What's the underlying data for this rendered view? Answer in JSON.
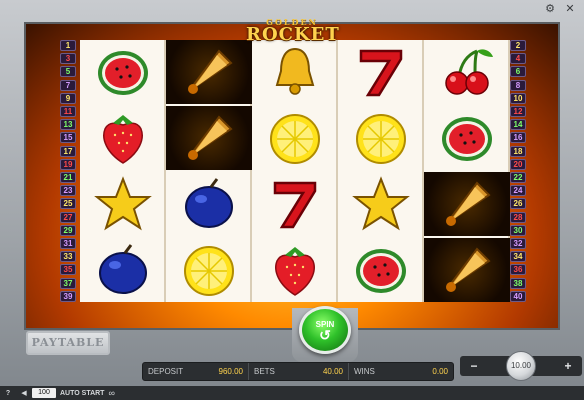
{
  "game": {
    "logo_top": "GOLDEN",
    "logo_main": "ROCKET"
  },
  "lines": {
    "left": [
      "1",
      "3",
      "5",
      "7",
      "9",
      "11",
      "13",
      "15",
      "17",
      "19",
      "21",
      "23",
      "25",
      "27",
      "29",
      "31",
      "33",
      "35",
      "37",
      "39"
    ],
    "right": [
      "2",
      "4",
      "6",
      "8",
      "10",
      "12",
      "14",
      "16",
      "18",
      "20",
      "22",
      "24",
      "26",
      "28",
      "30",
      "32",
      "34",
      "36",
      "38",
      "40"
    ]
  },
  "reels": [
    [
      "watermelon",
      "strawberry",
      "star",
      "plum"
    ],
    [
      "rocket",
      "rocket",
      "plum",
      "lemon"
    ],
    [
      "bell",
      "lemon",
      "seven",
      "strawberry"
    ],
    [
      "seven",
      "lemon",
      "star",
      "watermelon"
    ],
    [
      "cherry",
      "watermelon",
      "rocket",
      "rocket"
    ]
  ],
  "buttons": {
    "paytable": "PAYTABLE",
    "spin": "SPIN"
  },
  "info": {
    "deposit_label": "DEPOSIT",
    "deposit_value": "960.00",
    "bets_label": "BETS",
    "bets_value": "40.00",
    "wins_label": "WINS",
    "wins_value": "0.00"
  },
  "stake": {
    "minus": "−",
    "plus": "+",
    "value": "10.00"
  },
  "bottom": {
    "help": "?",
    "auto_count": "100",
    "auto_label": "AUTO START",
    "infinity": "∞"
  }
}
